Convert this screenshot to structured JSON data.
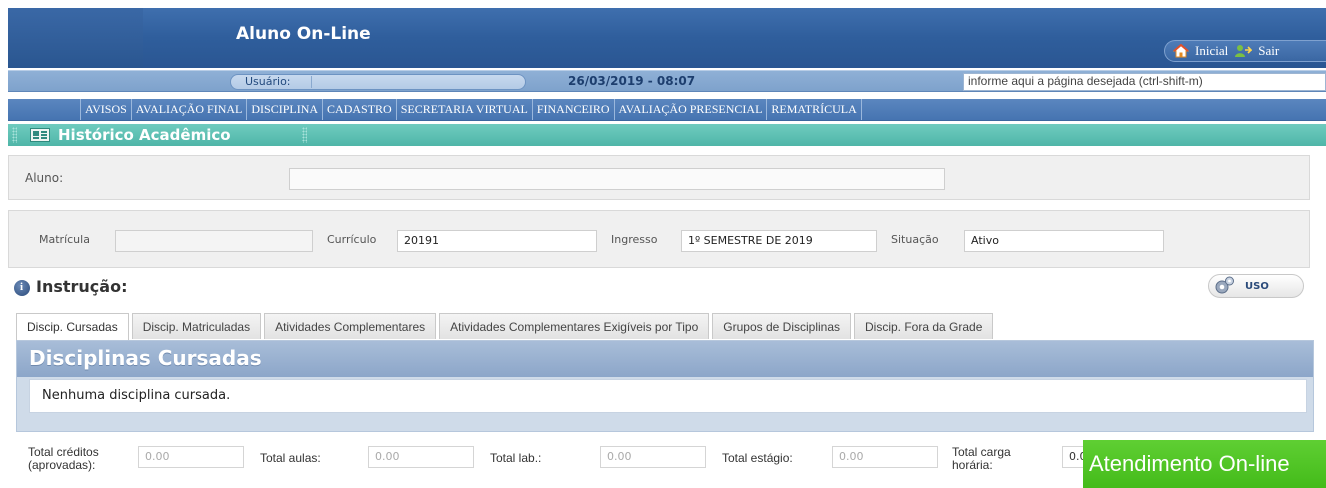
{
  "header": {
    "app_title": "Aluno On-Line",
    "nav": {
      "home_label": "Inicial",
      "exit_label": "Sair"
    }
  },
  "infobar": {
    "user_label": "Usuário:",
    "user_value": "",
    "datetime": "26/03/2019 - 08:07",
    "page_search_placeholder": "informe aqui a página desejada (ctrl-shift-m)"
  },
  "menu": {
    "items": [
      "AVISOS",
      "AVALIAÇÃO FINAL",
      "DISCIPLINA",
      "CADASTRO",
      "SECRETARIA VIRTUAL",
      "FINANCEIRO",
      "AVALIAÇÃO PRESENCIAL",
      "REMATRÍCULA"
    ]
  },
  "page": {
    "title": "Histórico Acadêmico"
  },
  "student": {
    "aluno_label": "Aluno:",
    "aluno_value": "",
    "matricula_label": "Matrícula",
    "matricula_value": "",
    "curriculo_label": "Currículo",
    "curriculo_value": "20191",
    "ingresso_label": "Ingresso",
    "ingresso_value": "1º SEMESTRE DE 2019",
    "situacao_label": "Situação",
    "situacao_value": "Ativo"
  },
  "instruction": {
    "title": "Instrução:",
    "uso_label": "USO"
  },
  "tabs": [
    {
      "label": "Discip. Cursadas",
      "active": true
    },
    {
      "label": "Discip. Matriculadas",
      "active": false
    },
    {
      "label": "Atividades Complementares",
      "active": false
    },
    {
      "label": "Atividades Complementares Exigíveis por Tipo",
      "active": false
    },
    {
      "label": "Grupos de Disciplinas",
      "active": false
    },
    {
      "label": "Discip. Fora da Grade",
      "active": false
    }
  ],
  "content": {
    "title": "Disciplinas Cursadas",
    "empty_message": "Nenhuma disciplina cursada."
  },
  "totals": {
    "creditos_label_1": "Total créditos",
    "creditos_label_2": "(aprovadas):",
    "creditos_value": "0.00",
    "aulas_label": "Total aulas:",
    "aulas_value": "0.00",
    "lab_label": "Total lab.:",
    "lab_value": "0.00",
    "estagio_label": "Total estágio:",
    "estagio_value": "0.00",
    "carga_label_1": "Total carga",
    "carga_label_2": "horária:",
    "carga_value": "0.0"
  },
  "chat": {
    "label": "Atendimento On-line"
  },
  "colors": {
    "header_blue": "#2f5e9c",
    "menu_blue": "#4674b1",
    "title_teal": "#4fb6a8",
    "chat_green": "#44bb1a"
  }
}
